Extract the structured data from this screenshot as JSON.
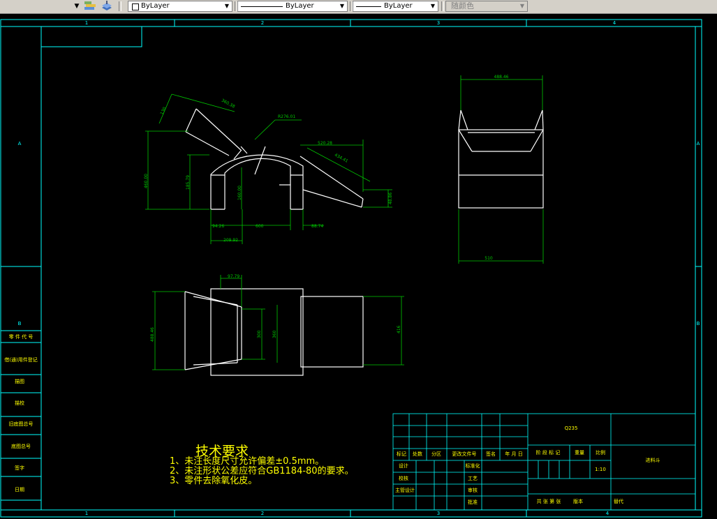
{
  "toolbar": {
    "layer_color_label": "ByLayer",
    "linetype_label": "ByLayer",
    "lineweight_label": "ByLayer",
    "plot_style_label": "随颜色"
  },
  "drawing": {
    "zone_columns": [
      "1",
      "2",
      "3",
      "4"
    ],
    "zone_rows": [
      "A",
      "B"
    ],
    "left_strip": {
      "labels": [
        "零 件 代 号",
        "借(通)用件登记",
        "描图",
        "描校",
        "旧底图总号",
        "底图总号",
        "签字",
        "日期"
      ]
    },
    "front_view_dims": {
      "d1": "130",
      "d2": "360.38",
      "radius": "R276.01",
      "d3": "520.28",
      "d4": "434.41",
      "d5": "460.00",
      "d6": "185.79",
      "d7": "160.00",
      "d8": "94.26",
      "d9": "600",
      "d10": "88.74",
      "d11": "209.92",
      "d12": "48.86"
    },
    "side_view_dims": {
      "top": "488.46",
      "bottom": "510"
    },
    "top_view_dims": {
      "top": "97.79",
      "left": "488.46",
      "mid1": "300",
      "mid2": "360",
      "right": "416"
    },
    "tech_requirements": {
      "title": "技术要求",
      "items": [
        "1、未注长度尺寸允许偏差±0.5mm。",
        "2、未注形状公差应符合GB1184-80的要求。",
        "3、零件去除氧化皮。"
      ]
    },
    "title_block": {
      "material": "Q235",
      "part_name": "进料斗",
      "scale_label": "比例",
      "scale_value": "1:10",
      "weight_label": "重量",
      "stage_label": "阶 段 标 记",
      "row_labels": [
        "标记",
        "处数",
        "分区",
        "更改文件号",
        "签名",
        "年 月 日"
      ],
      "left_labels": [
        "设计",
        "校核",
        "主管设计"
      ],
      "mid_labels": [
        "标准化",
        "工艺",
        "审核",
        "批准"
      ],
      "sheet_text": "共  张  第  张",
      "version_label": "版本",
      "replace_label": "替代"
    }
  },
  "colors": {
    "border": "#00ffff",
    "geometry": "#ffffff",
    "dimension": "#00c800",
    "text": "#ffff00",
    "background": "#000000"
  }
}
